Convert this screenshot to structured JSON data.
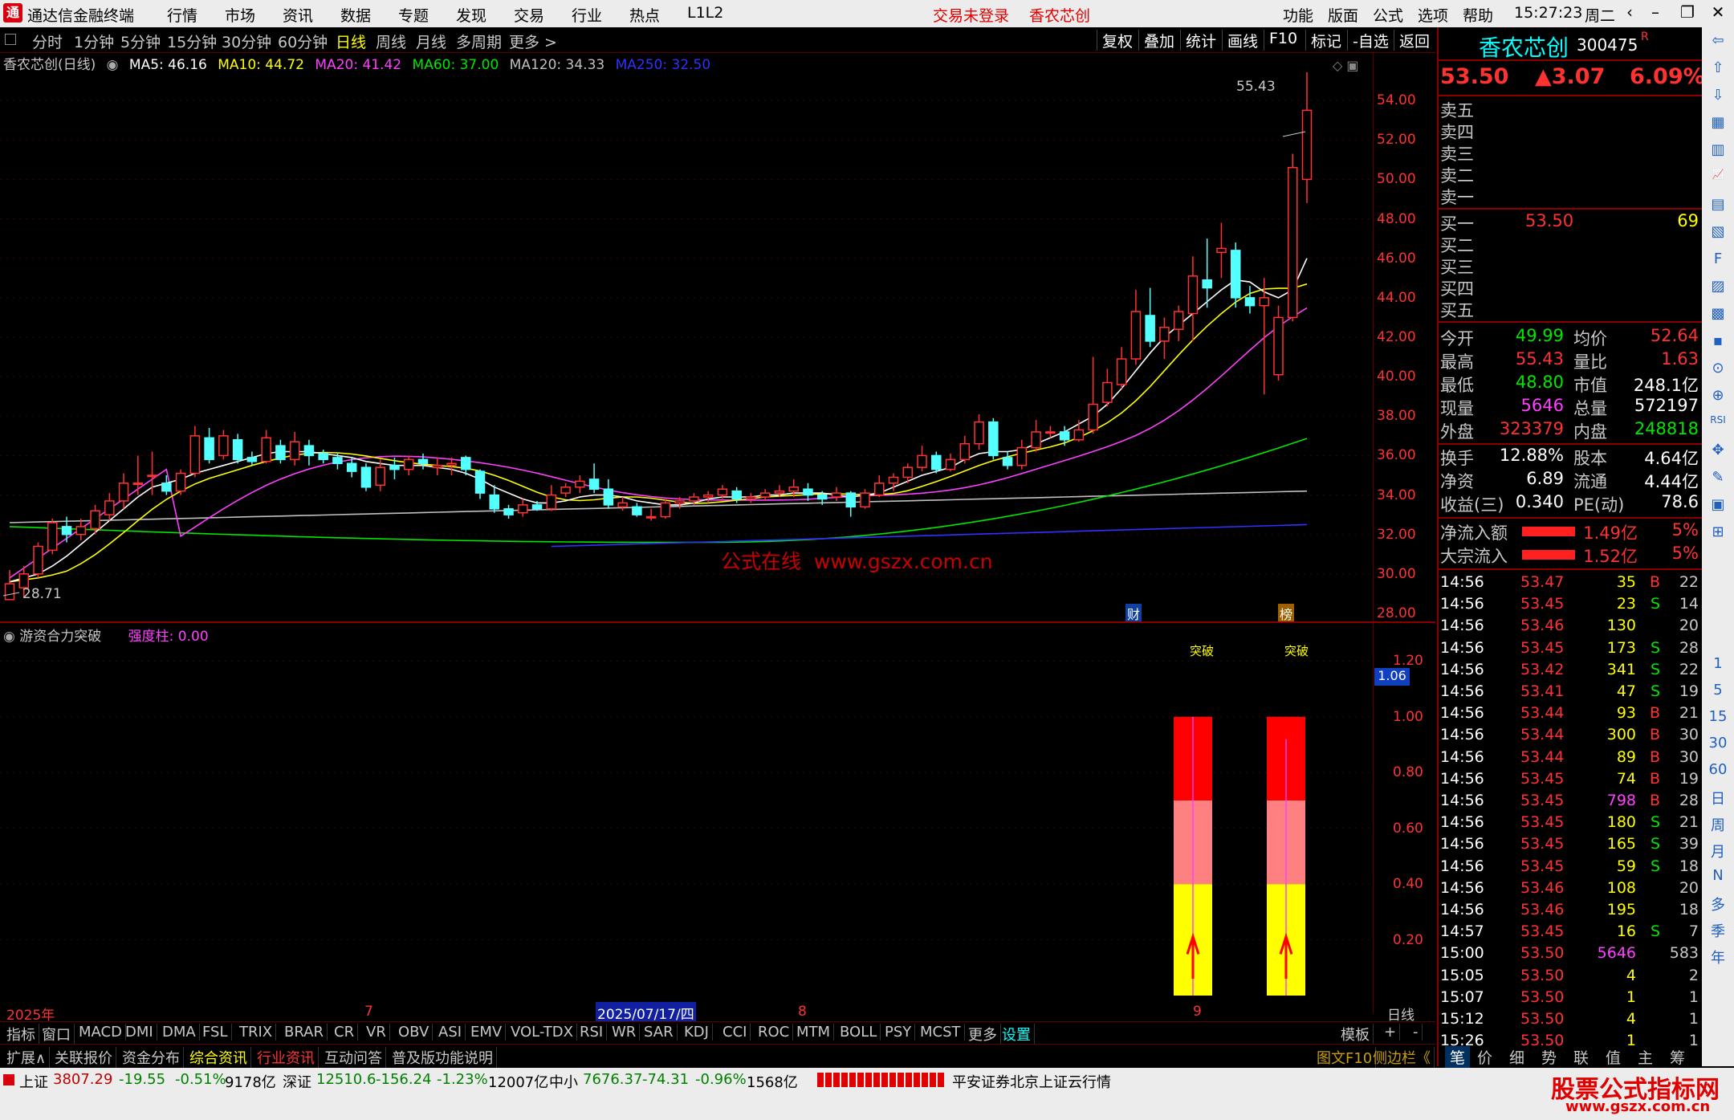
{
  "app": {
    "title": "通达信金融终端",
    "time": "15:27:23",
    "weekday": "周二"
  },
  "menu": {
    "items": [
      "行情",
      "市场",
      "资讯",
      "数据",
      "专题",
      "发现",
      "交易",
      "行业",
      "热点",
      "L1L2"
    ],
    "notice": "交易未登录",
    "stock_tag": "香农芯创",
    "right": [
      "功能",
      "版面",
      "公式",
      "选项",
      "帮助"
    ]
  },
  "periods": [
    "分时",
    "1分钟",
    "5分钟",
    "15分钟",
    "30分钟",
    "60分钟",
    "日线",
    "周线",
    "月线",
    "多周期",
    "更多 >"
  ],
  "active_period": "日线",
  "tools": [
    "复权",
    "叠加",
    "统计",
    "画线",
    "F10",
    "标记",
    "-自选",
    "返回"
  ],
  "ma": {
    "name": "香农芯创(日线)",
    "ma5": "MA5: 46.16",
    "ma10": "MA10: 44.72",
    "ma20": "MA20: 41.42",
    "ma60": "MA60: 37.00",
    "ma120": "MA120: 34.33",
    "ma250": "MA250: 32.50"
  },
  "chart_labels": {
    "high": "55.43",
    "low": "28.71",
    "watermark": "公式在线  www.gszx.com.cn",
    "tag1": "财",
    "tag2": "榜"
  },
  "price_axis": [
    "54.00",
    "52.00",
    "50.00",
    "48.00",
    "46.00",
    "44.00",
    "42.00",
    "40.00",
    "38.00",
    "36.00",
    "34.00",
    "32.00",
    "30.00",
    "28.00"
  ],
  "indicator": {
    "name": "游资合力突破",
    "param": "强度柱: 0.00",
    "axis": [
      "1.20",
      "1.00",
      "0.80",
      "0.60",
      "0.40",
      "0.20"
    ],
    "current": "1.06",
    "signal": "突破"
  },
  "dates": {
    "year": "2025年",
    "m7": "7",
    "cursor": "2025/07/17/四",
    "m8": "8",
    "m9": "9",
    "period": "日线"
  },
  "ind_tabs": [
    "指标",
    "窗口",
    "MACD",
    "DMI",
    "DMA",
    "FSL",
    "TRIX",
    "BRAR",
    "CR",
    "VR",
    "OBV",
    "ASI",
    "EMV",
    "VOL-TDX",
    "RSI",
    "WR",
    "SAR",
    "KDJ",
    "CCI",
    "ROC",
    "MTM",
    "BOLL",
    "PSY",
    "MCST",
    "更多",
    "设置"
  ],
  "ind_tabs_right": [
    "模板",
    "+",
    "-"
  ],
  "bottom_tabs": [
    "扩展∧",
    "关联报价",
    "资金分布",
    "综合资讯",
    "行业资讯",
    "互动问答",
    "普及版功能说明"
  ],
  "bottom_right": [
    "图文F10",
    "侧边栏《",
    "笔",
    "价",
    "细",
    "势",
    "联",
    "值",
    "主",
    "筹"
  ],
  "quote": {
    "name": "香农芯创",
    "code": "300475",
    "flag": "R",
    "price": "53.50",
    "change": "▲3.07",
    "pct": "6.09%",
    "sell": [
      "卖五",
      "卖四",
      "卖三",
      "卖二",
      "卖一"
    ],
    "buy": [
      {
        "l": "买一",
        "p": "53.50",
        "v": "69"
      },
      {
        "l": "买二",
        "p": "",
        "v": ""
      },
      {
        "l": "买三",
        "p": "",
        "v": ""
      },
      {
        "l": "买四",
        "p": "",
        "v": ""
      },
      {
        "l": "买五",
        "p": "",
        "v": ""
      }
    ],
    "stats": [
      {
        "l1": "今开",
        "v1": "49.99",
        "l2": "均价",
        "v2": "52.64",
        "c1": "green",
        "c2": "red"
      },
      {
        "l1": "最高",
        "v1": "55.43",
        "l2": "量比",
        "v2": "1.63",
        "c1": "red",
        "c2": "red"
      },
      {
        "l1": "最低",
        "v1": "48.80",
        "l2": "市值",
        "v2": "248.1亿",
        "c1": "green",
        "c2": "white"
      },
      {
        "l1": "现量",
        "v1": "5646",
        "l2": "总量",
        "v2": "572197",
        "c1": "mag",
        "c2": "white"
      },
      {
        "l1": "外盘",
        "v1": "323379",
        "l2": "内盘",
        "v2": "248818",
        "c1": "red",
        "c2": "green"
      },
      {
        "l1": "换手",
        "v1": "12.88%",
        "l2": "股本",
        "v2": "4.64亿",
        "c1": "white",
        "c2": "white"
      },
      {
        "l1": "净资",
        "v1": "6.89",
        "l2": "流通",
        "v2": "4.44亿",
        "c1": "white",
        "c2": "white"
      },
      {
        "l1": "收益(三)",
        "v1": "0.340",
        "l2": "PE(动)",
        "v2": "78.6",
        "c1": "white",
        "c2": "white"
      }
    ],
    "flow": [
      {
        "l": "净流入额",
        "v": "1.49亿",
        "p": "5%"
      },
      {
        "l": "大宗流入",
        "v": "1.52亿",
        "p": "5%"
      }
    ],
    "ticks": [
      [
        "14:56",
        "53.47",
        "35",
        "B",
        "22"
      ],
      [
        "14:56",
        "53.45",
        "23",
        "S",
        "14"
      ],
      [
        "14:56",
        "53.46",
        "130",
        "",
        "20"
      ],
      [
        "14:56",
        "53.45",
        "173",
        "S",
        "28"
      ],
      [
        "14:56",
        "53.42",
        "341",
        "S",
        "22"
      ],
      [
        "14:56",
        "53.41",
        "47",
        "S",
        "19"
      ],
      [
        "14:56",
        "53.44",
        "93",
        "B",
        "21"
      ],
      [
        "14:56",
        "53.44",
        "300",
        "B",
        "30"
      ],
      [
        "14:56",
        "53.44",
        "89",
        "B",
        "30"
      ],
      [
        "14:56",
        "53.45",
        "74",
        "B",
        "19"
      ],
      [
        "14:56",
        "53.45",
        "798",
        "B",
        "28"
      ],
      [
        "14:56",
        "53.45",
        "180",
        "S",
        "21"
      ],
      [
        "14:56",
        "53.45",
        "165",
        "S",
        "39"
      ],
      [
        "14:56",
        "53.45",
        "59",
        "S",
        "18"
      ],
      [
        "14:56",
        "53.46",
        "108",
        "",
        "20"
      ],
      [
        "14:56",
        "53.46",
        "195",
        "",
        "18"
      ],
      [
        "14:57",
        "53.45",
        "16",
        "S",
        "7"
      ],
      [
        "15:00",
        "53.50",
        "5646",
        "",
        "583"
      ],
      [
        "15:05",
        "53.50",
        "4",
        "",
        "2"
      ],
      [
        "15:07",
        "53.50",
        "1",
        "",
        "1"
      ],
      [
        "15:12",
        "53.50",
        "4",
        "",
        "1"
      ],
      [
        "15:26",
        "53.50",
        "1",
        "",
        "1"
      ]
    ]
  },
  "side_icons": [
    "1",
    "5",
    "15",
    "30",
    "60",
    "日",
    "周",
    "月",
    "N",
    "多",
    "季",
    "年"
  ],
  "status": {
    "sh_name": "上证",
    "sh": "3807.29",
    "sh_chg": "-19.55",
    "sh_pct": "-0.51%",
    "sh_amt": "9178亿",
    "sz_name": "深证",
    "sz": "12510.6",
    "sz_chg": "-156.24",
    "sz_pct": "-1.23%",
    "sz_amt": "12007亿",
    "zx_name": "中小",
    "zx": "7676.37",
    "zx_chg": "-74.31",
    "zx_pct": "-0.96%",
    "zx_amt": "1568亿",
    "broker": "平安证券北京上证云行情"
  },
  "brand": {
    "text": "股票公式指标网",
    "url": "www.gszx.com.cn"
  },
  "colors": {
    "up": "#ff3232",
    "down": "#54ffff",
    "ma5": "#ffffff",
    "ma10": "#ffff00",
    "ma20": "#ff40ff",
    "ma60": "#00e600",
    "ma120": "#c0c0c0",
    "ma250": "#3030ff"
  },
  "chart_data": {
    "type": "candlestick",
    "ylim": [
      28,
      56
    ],
    "candles": [
      [
        28.7,
        29.5,
        28.71,
        30.2
      ],
      [
        29.3,
        30.0,
        28.8,
        30.4
      ],
      [
        30.0,
        31.4,
        29.8,
        31.6
      ],
      [
        31.2,
        32.6,
        31.0,
        32.8
      ],
      [
        32.4,
        32.0,
        31.6,
        32.9
      ],
      [
        32.0,
        32.4,
        31.7,
        32.8
      ],
      [
        32.3,
        33.2,
        32.0,
        33.5
      ],
      [
        33.0,
        33.7,
        32.7,
        34.1
      ],
      [
        33.7,
        34.6,
        33.3,
        35.1
      ],
      [
        34.6,
        34.6,
        34.0,
        36.0
      ],
      [
        35.0,
        35.0,
        34.0,
        36.2
      ],
      [
        34.6,
        34.2,
        34.0,
        35.0
      ],
      [
        34.2,
        35.1,
        34.0,
        35.3
      ],
      [
        35.1,
        37.0,
        34.9,
        37.5
      ],
      [
        36.9,
        35.8,
        35.6,
        37.4
      ],
      [
        36.0,
        37.0,
        35.8,
        37.3
      ],
      [
        36.8,
        35.8,
        35.6,
        37.1
      ],
      [
        35.9,
        35.7,
        35.5,
        36.2
      ],
      [
        35.7,
        36.9,
        35.6,
        37.3
      ],
      [
        36.5,
        35.8,
        35.6,
        36.8
      ],
      [
        35.8,
        36.7,
        35.5,
        37.2
      ],
      [
        36.5,
        36.0,
        35.5,
        36.8
      ],
      [
        36.1,
        35.8,
        35.6,
        36.3
      ],
      [
        35.9,
        35.6,
        35.3,
        36.1
      ],
      [
        35.6,
        35.2,
        34.9,
        35.9
      ],
      [
        35.4,
        34.4,
        34.2,
        35.6
      ],
      [
        34.5,
        35.4,
        34.2,
        35.8
      ],
      [
        35.5,
        35.3,
        34.8,
        35.9
      ],
      [
        35.3,
        35.8,
        35.0,
        36.0
      ],
      [
        35.8,
        35.6,
        35.3,
        36.1
      ],
      [
        35.4,
        35.5,
        35.0,
        35.9
      ],
      [
        35.5,
        35.6,
        35.0,
        35.9
      ],
      [
        35.9,
        35.3,
        35.0,
        36.0
      ],
      [
        35.2,
        34.1,
        33.8,
        35.3
      ],
      [
        34.0,
        33.3,
        33.1,
        34.5
      ],
      [
        33.3,
        33.0,
        32.8,
        33.5
      ],
      [
        33.1,
        33.5,
        32.9,
        33.8
      ],
      [
        33.5,
        33.3,
        33.2,
        33.7
      ],
      [
        33.3,
        34.0,
        33.2,
        34.5
      ],
      [
        34.1,
        34.4,
        33.9,
        34.6
      ],
      [
        34.4,
        34.7,
        34.1,
        35.0
      ],
      [
        34.8,
        34.3,
        34.1,
        35.6
      ],
      [
        34.3,
        33.5,
        33.3,
        34.8
      ],
      [
        33.4,
        33.6,
        33.2,
        33.9
      ],
      [
        33.4,
        33.0,
        32.9,
        33.6
      ],
      [
        32.9,
        32.9,
        32.7,
        33.3
      ],
      [
        32.9,
        33.6,
        32.8,
        33.8
      ],
      [
        33.6,
        33.7,
        33.3,
        33.9
      ],
      [
        33.7,
        33.9,
        33.5,
        34.1
      ],
      [
        33.9,
        34.0,
        33.6,
        34.2
      ],
      [
        34.0,
        34.3,
        33.8,
        34.5
      ],
      [
        34.2,
        33.8,
        33.6,
        34.4
      ],
      [
        33.8,
        33.9,
        33.6,
        34.1
      ],
      [
        33.9,
        34.1,
        33.7,
        34.3
      ],
      [
        34.1,
        34.2,
        33.9,
        34.5
      ],
      [
        34.2,
        34.4,
        33.9,
        34.8
      ],
      [
        34.3,
        34.0,
        33.7,
        34.6
      ],
      [
        34.0,
        33.8,
        33.5,
        34.2
      ],
      [
        33.9,
        34.1,
        33.7,
        34.4
      ],
      [
        34.1,
        33.4,
        32.9,
        34.2
      ],
      [
        33.4,
        34.1,
        33.3,
        34.3
      ],
      [
        34.0,
        34.6,
        33.9,
        35.0
      ],
      [
        34.6,
        34.9,
        34.2,
        35.1
      ],
      [
        34.9,
        35.4,
        34.6,
        35.6
      ],
      [
        35.4,
        36.0,
        35.2,
        36.5
      ],
      [
        36.0,
        35.3,
        35.1,
        36.2
      ],
      [
        35.3,
        35.8,
        35.2,
        36.1
      ],
      [
        35.8,
        36.6,
        35.6,
        37.0
      ],
      [
        36.6,
        37.7,
        36.3,
        38.1
      ],
      [
        37.7,
        36.0,
        35.8,
        37.9
      ],
      [
        35.9,
        35.5,
        35.3,
        36.2
      ],
      [
        35.5,
        36.4,
        35.3,
        36.8
      ],
      [
        36.4,
        37.2,
        36.2,
        37.8
      ],
      [
        37.2,
        37.2,
        36.9,
        37.5
      ],
      [
        37.2,
        36.8,
        36.5,
        37.5
      ],
      [
        36.8,
        37.3,
        36.7,
        37.8
      ],
      [
        37.3,
        38.6,
        37.1,
        41.0
      ],
      [
        38.7,
        39.7,
        38.5,
        40.4
      ],
      [
        39.6,
        40.9,
        39.4,
        41.5
      ],
      [
        40.9,
        43.3,
        40.6,
        44.4
      ],
      [
        43.1,
        41.8,
        41.5,
        44.5
      ],
      [
        41.8,
        42.5,
        40.9,
        43.0
      ],
      [
        42.4,
        43.3,
        41.8,
        43.6
      ],
      [
        43.2,
        45.1,
        41.8,
        46.1
      ],
      [
        44.9,
        44.5,
        43.5,
        47.0
      ],
      [
        46.3,
        46.5,
        45.0,
        47.8
      ],
      [
        46.4,
        44.0,
        43.5,
        46.8
      ],
      [
        44.0,
        43.6,
        43.2,
        44.6
      ],
      [
        43.6,
        44.0,
        39.1,
        45.0
      ],
      [
        40.1,
        43.0,
        39.8,
        43.6
      ],
      [
        43.0,
        50.6,
        42.8,
        51.3
      ],
      [
        50.0,
        53.5,
        48.8,
        55.43
      ]
    ],
    "ma5": [
      29.6,
      29.8,
      30.0,
      30.4,
      30.9,
      31.5,
      32.1,
      32.7,
      33.3,
      33.9,
      34.4,
      34.6,
      34.8,
      35.1,
      35.3,
      35.5,
      35.7,
      35.9,
      36.1,
      36.2,
      36.2,
      36.2,
      36.1,
      36.0,
      35.9,
      35.7,
      35.6,
      35.5,
      35.5,
      35.5,
      35.4,
      35.3,
      35.1,
      34.8,
      34.4,
      34.1,
      33.8,
      33.6,
      33.6,
      33.7,
      33.9,
      34.0,
      34.0,
      33.9,
      33.7,
      33.6,
      33.5,
      33.5,
      33.6,
      33.8,
      33.9,
      33.9,
      33.9,
      34.0,
      34.0,
      34.1,
      34.1,
      34.1,
      34.0,
      33.9,
      34.0,
      34.1,
      34.4,
      34.7,
      35.0,
      35.2,
      35.4,
      35.8,
      36.1,
      36.2,
      36.2,
      36.3,
      36.6,
      36.9,
      37.2,
      37.6,
      38.0,
      38.6,
      39.4,
      40.3,
      41.2,
      42.0,
      42.6,
      43.2,
      43.8,
      44.4,
      44.9,
      44.8,
      44.3,
      44.0,
      44.4,
      46.0
    ]
  }
}
